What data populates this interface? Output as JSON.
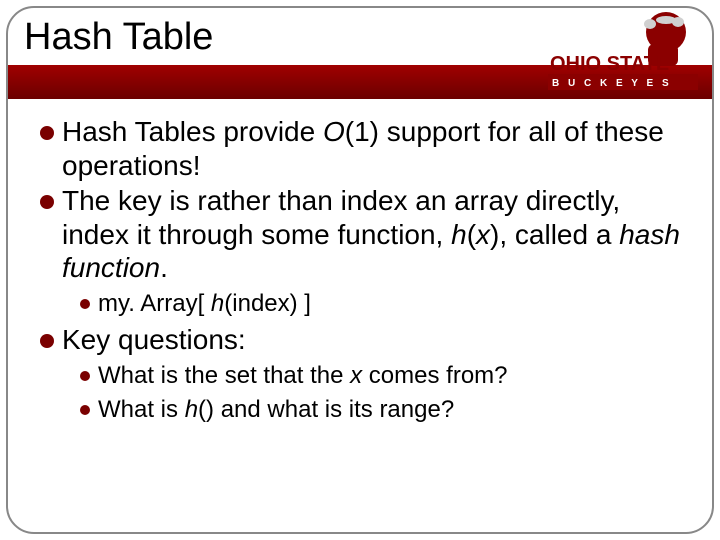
{
  "title": "Hash Table",
  "logo": {
    "name": "Ohio State Buckeyes",
    "text1": "OHIO STATE",
    "text2": "B U C K E Y E S"
  },
  "bullets": [
    {
      "level": 1,
      "segments": [
        {
          "t": "Hash Tables provide "
        },
        {
          "t": "O",
          "i": true
        },
        {
          "t": "(1) support for all of these operations!"
        }
      ]
    },
    {
      "level": 1,
      "segments": [
        {
          "t": "The key is rather than index an array directly, index it through some function, "
        },
        {
          "t": "h",
          "i": true
        },
        {
          "t": "("
        },
        {
          "t": "x",
          "i": true
        },
        {
          "t": "), called a "
        },
        {
          "t": "hash function",
          "i": true
        },
        {
          "t": "."
        }
      ]
    },
    {
      "level": 2,
      "segments": [
        {
          "t": "my. Array[ "
        },
        {
          "t": "h",
          "i": true
        },
        {
          "t": "(index) ]"
        }
      ]
    },
    {
      "level": 1,
      "segments": [
        {
          "t": "Key questions:"
        }
      ]
    },
    {
      "level": 2,
      "segments": [
        {
          "t": "What is the set that the "
        },
        {
          "t": "x",
          "i": true
        },
        {
          "t": " comes from?"
        }
      ]
    },
    {
      "level": 2,
      "segments": [
        {
          "t": "What is "
        },
        {
          "t": "h",
          "i": true
        },
        {
          "t": "() and what is its range?"
        }
      ]
    }
  ]
}
